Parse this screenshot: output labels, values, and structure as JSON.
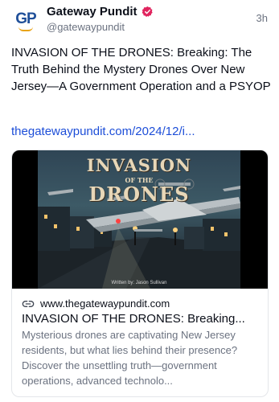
{
  "post": {
    "author": {
      "avatar_text": "GP",
      "display_name": "Gateway Pundit",
      "handle": "@gatewaypundit",
      "verified_icon": "verified-badge-icon"
    },
    "timestamp": "3h",
    "text": "INVASION OF THE DRONES: Breaking: The Truth Behind the Mystery Drones Over New Jersey—A Government Operation and a PSYOP",
    "link_text": "thegatewaypundit.com/2024/12/i...",
    "link_card": {
      "image": {
        "title_line_1": "INVASION",
        "title_line_2": "OF THE",
        "title_line_3": "DRONES",
        "credit": "Written by: Jason Sullivan"
      },
      "domain_icon": "link-icon",
      "domain": "www.thegatewaypundit.com",
      "title": "INVASION OF THE DRONES: Breaking...",
      "description": "Mysterious drones are captivating New Jersey residents, but what lies behind their presence? Discover the unsettling truth—government operations, advanced technolo..."
    }
  },
  "colors": {
    "text": "#0b0f19",
    "muted": "#6b7280",
    "link": "#1d4ed8",
    "verified": "#e0245e",
    "brand_blue": "#1f4f99",
    "brand_gold": "#e8a317"
  }
}
